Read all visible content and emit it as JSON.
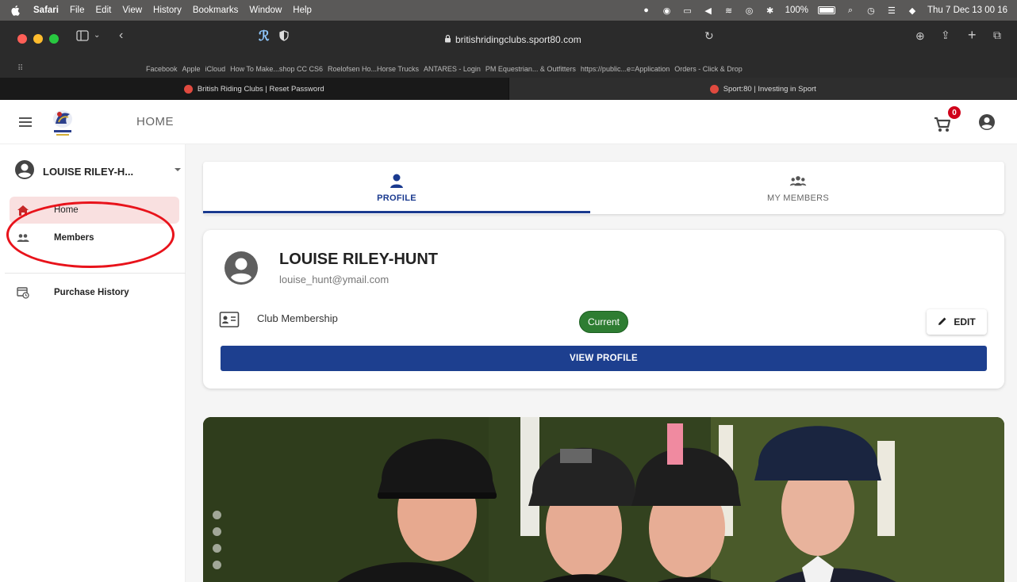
{
  "menubar": {
    "app": "Safari",
    "items": [
      "File",
      "Edit",
      "View",
      "History",
      "Bookmarks",
      "Window",
      "Help"
    ],
    "battery": "100%",
    "datetime": "Thu 7 Dec  13 00 16"
  },
  "browser": {
    "url": "britishridingclubs.sport80.com",
    "bookmarks": [
      "Facebook",
      "Apple",
      "iCloud",
      "How To Make...shop CC CS6",
      "Roelofsen Ho...Horse Trucks",
      "ANTARES - Login",
      "PM Equestrian... & Outfitters",
      "https://public...e=Application",
      "Orders - Click & Drop"
    ],
    "tabs": [
      {
        "title": "British Riding Clubs | Reset Password"
      },
      {
        "title": "Sport:80 | Investing in Sport"
      }
    ]
  },
  "header": {
    "title": "HOME",
    "cart_count": "0"
  },
  "sidebar": {
    "user_name": "LOUISE RILEY-H...",
    "items": [
      {
        "label": "Home",
        "icon": "home-icon"
      },
      {
        "label": "Members",
        "icon": "people-icon"
      },
      {
        "label": "Purchase History",
        "icon": "purchase-history-icon"
      }
    ]
  },
  "profile_tabs": [
    {
      "label": "PROFILE",
      "icon": "person-icon"
    },
    {
      "label": "MY MEMBERS",
      "icon": "group-icon"
    }
  ],
  "profile": {
    "name": "LOUISE RILEY-HUNT",
    "email": "louise_hunt@ymail.com",
    "membership_label": "Club Membership",
    "membership_status": "Current",
    "edit_label": "EDIT",
    "view_profile_label": "VIEW PROFILE"
  },
  "colors": {
    "primary": "#1d3f8f",
    "status_current": "#2e7d32",
    "annotation_red": "#e8131b"
  }
}
